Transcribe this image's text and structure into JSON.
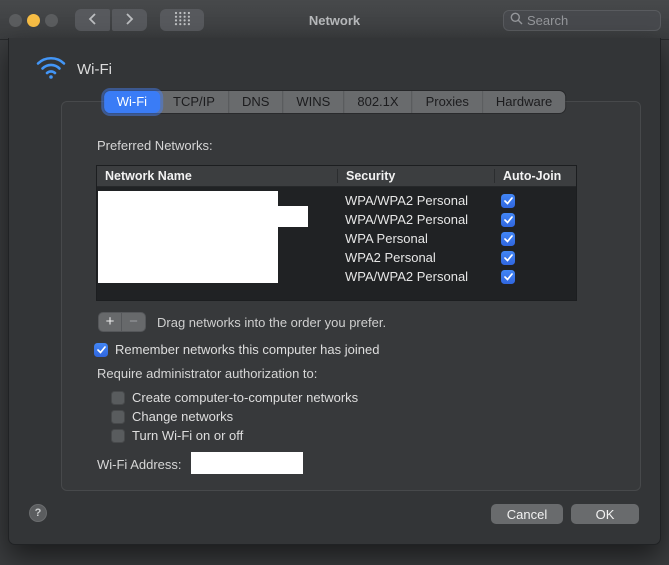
{
  "window": {
    "title": "Network"
  },
  "toolbar": {
    "search_placeholder": "Search"
  },
  "colors": {
    "accent_blue": "#3a7cf6",
    "checkbox_blue": "#3a7af0",
    "wifi_icon_blue": "#4396f7",
    "traffic_yellow": "#f7bd45",
    "redaction": "#ffffff",
    "sheet_bg": "#333537",
    "table_bg": "#202224"
  },
  "sheet": {
    "header": {
      "label": "Wi-Fi"
    },
    "tabs": [
      {
        "label": "Wi-Fi",
        "selected": true
      },
      {
        "label": "TCP/IP",
        "selected": false
      },
      {
        "label": "DNS",
        "selected": false
      },
      {
        "label": "WINS",
        "selected": false
      },
      {
        "label": "802.1X",
        "selected": false
      },
      {
        "label": "Proxies",
        "selected": false
      },
      {
        "label": "Hardware",
        "selected": false
      }
    ],
    "preferred_networks": {
      "label": "Preferred Networks:",
      "columns": [
        "Network Name",
        "Security",
        "Auto-Join"
      ],
      "rows": [
        {
          "name": "",
          "security": "WPA/WPA2 Personal",
          "auto_join": true
        },
        {
          "name": "",
          "security": "WPA/WPA2 Personal",
          "auto_join": true
        },
        {
          "name": "",
          "security": "WPA Personal",
          "auto_join": true
        },
        {
          "name": "",
          "security": "WPA2 Personal",
          "auto_join": true
        },
        {
          "name": "",
          "security": "WPA/WPA2 Personal",
          "auto_join": true
        }
      ],
      "add_label": "+",
      "remove_label": "−",
      "drag_hint": "Drag networks into the order you prefer."
    },
    "options": {
      "remember": {
        "label": "Remember networks this computer has joined",
        "checked": true
      },
      "require_admin_label": "Require administrator authorization to:",
      "admin_options": [
        {
          "label": "Create computer-to-computer networks",
          "checked": false
        },
        {
          "label": "Change networks",
          "checked": false
        },
        {
          "label": "Turn Wi-Fi on or off",
          "checked": false
        }
      ]
    },
    "wifi_address_label": "Wi-Fi Address:",
    "buttons": {
      "help": "?",
      "cancel": "Cancel",
      "ok": "OK"
    }
  }
}
